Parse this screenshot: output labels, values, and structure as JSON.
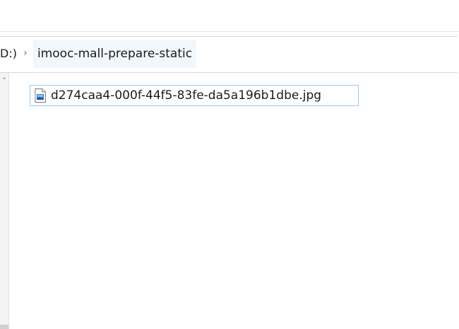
{
  "breadcrumb": {
    "previous": "D:)",
    "separator": "›",
    "current": "imooc-mall-prepare-static"
  },
  "nav_pane": {
    "scroll_up_glyph": "˄"
  },
  "files": [
    {
      "name": "d274caa4-000f-44f5-83fe-da5a196b1dbe.jpg",
      "icon": "image-file-icon",
      "selected": false,
      "focused": true
    }
  ],
  "colors": {
    "focus_border": "#99c9ef",
    "breadcrumb_highlight": "#f2f7fd"
  }
}
